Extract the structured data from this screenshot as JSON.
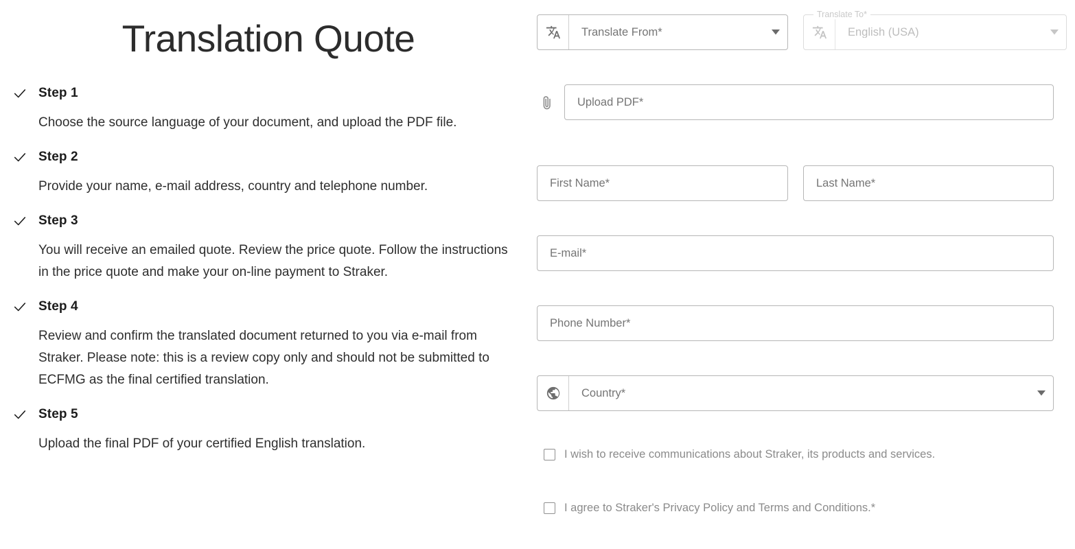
{
  "page": {
    "title": "Translation Quote"
  },
  "steps": [
    {
      "icon": "check-icon",
      "label": "Step 1",
      "body": "Choose the source language of your document, and upload the PDF file."
    },
    {
      "icon": "check-icon",
      "label": "Step 2",
      "body": "Provide your name, e-mail address, country and telephone number."
    },
    {
      "icon": "check-icon",
      "label": "Step 3",
      "body": "You will receive an emailed quote. Review the price quote. Follow the instructions in the price quote and make your on-line payment to Straker."
    },
    {
      "icon": "check-icon",
      "label": "Step 4",
      "body": "Review and confirm the translated document returned to you via e-mail from Straker. Please note: this is a review copy only and should not be submitted to ECFMG as the final certified translation."
    },
    {
      "icon": "check-icon",
      "label": "Step 5",
      "body": "Upload the final PDF of your certified English translation."
    }
  ],
  "form": {
    "translate_from": {
      "icon": "translate-icon",
      "placeholder": "Translate From*",
      "value": "",
      "caret": "chevron-down-icon"
    },
    "translate_to": {
      "icon": "translate-icon",
      "floating_label": "Translate To*",
      "value": "English (USA)",
      "caret": "chevron-down-icon",
      "disabled": true
    },
    "upload_pdf": {
      "icon": "paperclip-icon",
      "placeholder": "Upload PDF*",
      "value": ""
    },
    "first_name": {
      "placeholder": "First Name*",
      "value": ""
    },
    "last_name": {
      "placeholder": "Last Name*",
      "value": ""
    },
    "email": {
      "placeholder": "E-mail*",
      "value": ""
    },
    "phone": {
      "placeholder": "Phone Number*",
      "value": ""
    },
    "country": {
      "icon": "globe-icon",
      "placeholder": "Country*",
      "value": "",
      "caret": "chevron-down-icon"
    },
    "consent_marketing": {
      "label": "I wish to receive communications about Straker, its products and services.",
      "checked": false
    },
    "consent_privacy": {
      "label": "I agree to Straker's Privacy Policy and Terms and Conditions.*",
      "checked": false
    }
  },
  "colors": {
    "page_background": "#ffffff",
    "title_text": "#2c2c2c",
    "body_text": "#2e2e2e",
    "placeholder_text": "#9a9a9a",
    "disabled_text": "#bdbdbd",
    "field_border": "#b6b6b6",
    "disabled_border": "#dcdcdc",
    "icon_gray": "#6e6e6e",
    "checkbox_border": "#8f8f8f"
  }
}
